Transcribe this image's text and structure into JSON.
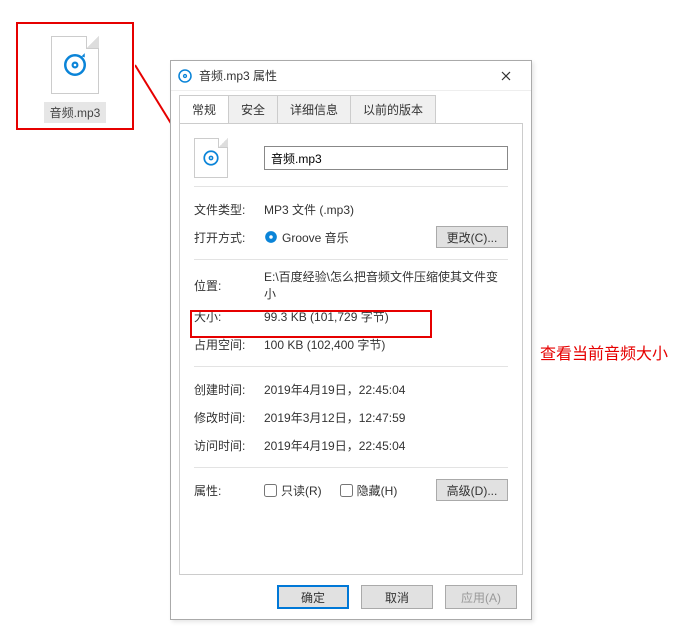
{
  "file_icon": {
    "filename": "音频.mp3"
  },
  "dialog": {
    "title": "音频.mp3 属性",
    "tabs": [
      "常规",
      "安全",
      "详细信息",
      "以前的版本"
    ],
    "filename": "音频.mp3",
    "rows": {
      "filetype_label": "文件类型:",
      "filetype_value": "MP3 文件 (.mp3)",
      "openwith_label": "打开方式:",
      "openwith_value": "Groove 音乐",
      "change_button": "更改(C)...",
      "location_label": "位置:",
      "location_value": "E:\\百度经验\\怎么把音频文件压缩使其文件变小",
      "size_label": "大小:",
      "size_value": "99.3 KB (101,729 字节)",
      "sizedisk_label": "占用空间:",
      "sizedisk_value": "100 KB (102,400 字节)",
      "created_label": "创建时间:",
      "created_value": "2019年4月19日，22:45:04",
      "modified_label": "修改时间:",
      "modified_value": "2019年3月12日，12:47:59",
      "accessed_label": "访问时间:",
      "accessed_value": "2019年4月19日，22:45:04",
      "attrs_label": "属性:",
      "readonly": "只读(R)",
      "hidden": "隐藏(H)",
      "advanced_button": "高级(D)..."
    },
    "buttons": {
      "ok": "确定",
      "cancel": "取消",
      "apply": "应用(A)"
    }
  },
  "annotation": "查看当前音频大小"
}
